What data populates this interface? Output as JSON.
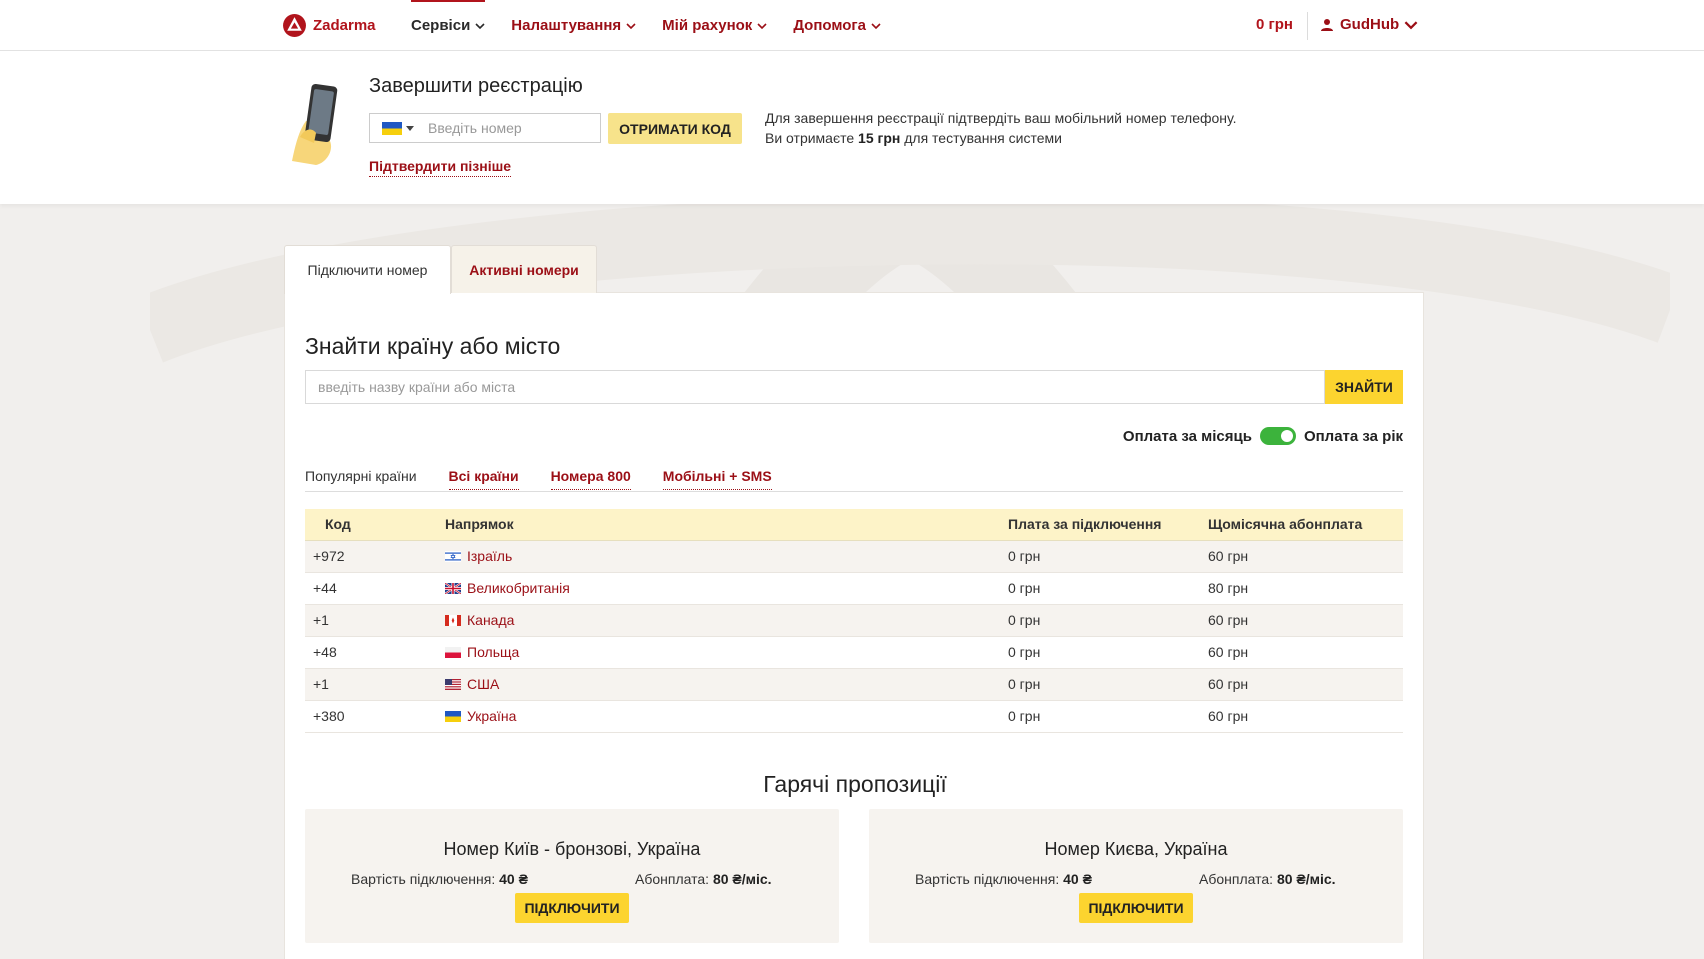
{
  "brand": {
    "name": "Zadarma",
    "color": "#b1141c"
  },
  "nav": {
    "items": [
      "Сервіси",
      "Налаштування",
      "Мій рахунок",
      "Допомога"
    ],
    "balance": "0 грн",
    "user": "GudHub"
  },
  "registration": {
    "title": "Завершити реєстрацію",
    "phone_placeholder": "Введіть номер",
    "get_code_label": "ОТРИМАТИ КОД",
    "confirm_later": "Підтвердити пізніше",
    "info_line1": "Для завершення реєстрації підтвердіть ваш мобільний номер телефону.",
    "info_line2_prefix": "Ви отримаєте ",
    "info_amount": "15 грн",
    "info_line2_suffix": " для тестування системи"
  },
  "tabs": {
    "connect": "Підключити номер",
    "active": "Активні номери"
  },
  "search": {
    "title": "Знайти країну або місто",
    "placeholder": "введіть назву країни або міста",
    "button": "ЗНАЙТИ"
  },
  "payment": {
    "monthly": "Оплата за місяць",
    "yearly": "Оплата за рік",
    "selected": "yearly"
  },
  "filters": [
    "Популярні країни",
    "Всі країни",
    "Номера 800",
    "Мобільні + SMS"
  ],
  "table": {
    "headers": [
      "Код",
      "Напрямок",
      "Плата за підключення",
      "Щомісячна абонплата"
    ],
    "rows": [
      {
        "code": "+972",
        "country": "Ізраїль",
        "fee": "0 грн",
        "monthly": "60 грн"
      },
      {
        "code": "+44",
        "country": "Великобританія",
        "fee": "0 грн",
        "monthly": "80 грн"
      },
      {
        "code": "+1",
        "country": "Канада",
        "fee": "0 грн",
        "monthly": "60 грн"
      },
      {
        "code": "+48",
        "country": "Польща",
        "fee": "0 грн",
        "monthly": "60 грн"
      },
      {
        "code": "+1",
        "country": "США",
        "fee": "0 грн",
        "monthly": "60 грн"
      },
      {
        "code": "+380",
        "country": "Україна",
        "fee": "0 грн",
        "monthly": "60 грн"
      }
    ]
  },
  "hot": {
    "title": "Гарячі пропозиції",
    "offers": [
      {
        "title": "Номер Київ - бронзові, Україна",
        "cost_label": "Вартість підключення: ",
        "cost": "40 ₴",
        "sub_label": "Абонплата: ",
        "sub": "80 ₴/міс.",
        "button": "ПІДКЛЮЧИТИ"
      },
      {
        "title": "Номер Києва, Україна",
        "cost_label": "Вартість підключення: ",
        "cost": "40 ₴",
        "sub_label": "Абонплата: ",
        "sub": "80 ₴/міс.",
        "button": "ПІДКЛЮЧИТИ"
      }
    ]
  }
}
